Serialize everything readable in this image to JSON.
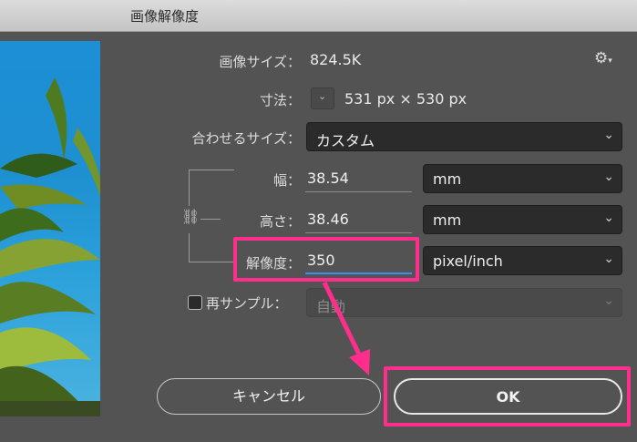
{
  "window": {
    "title": "画像解像度"
  },
  "info": {
    "image_size_label": "画像サイズ：",
    "image_size_value": "824.5K",
    "dimensions_label": "寸法：",
    "dimensions_value": "531 px × 530 px",
    "gear_icon": "gear-icon"
  },
  "fit_to": {
    "label": "合わせるサイズ：",
    "value": "カスタム"
  },
  "width": {
    "label": "幅：",
    "value": "38.54",
    "unit": "mm"
  },
  "height": {
    "label": "高さ：",
    "value": "38.46",
    "unit": "mm"
  },
  "resolution": {
    "label": "解像度：",
    "value": "350",
    "unit": "pixel/inch"
  },
  "resample": {
    "label": "再サンプル：",
    "value": "自動",
    "checked": false
  },
  "buttons": {
    "cancel": "キャンセル",
    "ok": "OK"
  },
  "colors": {
    "highlight": "#ff2d8c",
    "focus": "#3a8ef0",
    "background": "#535353"
  }
}
